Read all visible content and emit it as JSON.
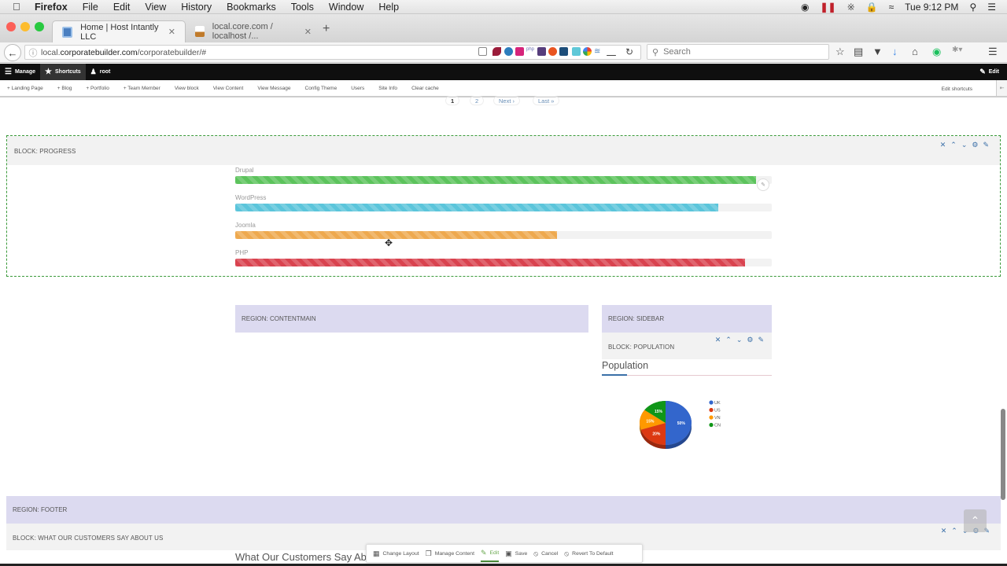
{
  "menubar": {
    "app": "Firefox",
    "items": [
      "File",
      "Edit",
      "View",
      "History",
      "Bookmarks",
      "Tools",
      "Window",
      "Help"
    ],
    "clock": "Tue 9:12 PM"
  },
  "tabs": [
    {
      "title": "Home | Host Intantly LLC",
      "active": true
    },
    {
      "title": "local.core.com / localhost /...",
      "active": false
    }
  ],
  "navbar": {
    "url_prefix": "local.",
    "url_domain": "corporatebuilder.com",
    "url_path": "/corporatebuilder/#",
    "search_placeholder": "Search"
  },
  "toolbar": {
    "manage": "Manage",
    "shortcuts": "Shortcuts",
    "user": "root",
    "edit": "Edit"
  },
  "shortcuts": {
    "items": [
      "+ Landing Page",
      "+ Blog",
      "+ Portfolio",
      "+ Team Member",
      "View block",
      "View Content",
      "View Message",
      "Config Theme",
      "Users",
      "Site Info",
      "Clear cache"
    ],
    "edit_shortcuts": "Edit shortcuts"
  },
  "pager": {
    "pages": [
      "1",
      "2"
    ],
    "next": "Next ›",
    "last": "Last »",
    "current": "1"
  },
  "progress_block": {
    "label": "BLOCK: PROGRESS",
    "bars": [
      {
        "name": "Drupal",
        "percent": 97,
        "color": "#5cc35c"
      },
      {
        "name": "WordPress",
        "percent": 90,
        "color": "#5bc5db"
      },
      {
        "name": "Joomla",
        "percent": 60,
        "color": "#eea94f"
      },
      {
        "name": "PHP",
        "percent": 95,
        "color": "#d9434f"
      }
    ]
  },
  "regions": {
    "contentmain": "REGION: CONTENTMAIN",
    "sidebar": "REGION: SIDEBAR",
    "footer": "REGION: FOOTER"
  },
  "population_block": {
    "label": "BLOCK: POPULATION",
    "title": "Population"
  },
  "chart_data": {
    "type": "pie",
    "title": "Population",
    "categories": [
      "UK",
      "US",
      "VN",
      "CN"
    ],
    "values": [
      50,
      20,
      15,
      15
    ],
    "labels": [
      "50%",
      "20%",
      "15%",
      "15%"
    ],
    "colors": [
      "#3366cc",
      "#dc3912",
      "#ff9900",
      "#109618"
    ],
    "legend": "right"
  },
  "customers_block": {
    "label": "BLOCK: WHAT OUR CUSTOMERS SAY ABOUT US",
    "title": "What Our Customers Say Abo"
  },
  "bottombar": {
    "change_layout": "Change Layout",
    "manage_content": "Manage Content",
    "edit": "Edit",
    "save": "Save",
    "cancel": "Cancel",
    "revert": "Revert To Default"
  }
}
